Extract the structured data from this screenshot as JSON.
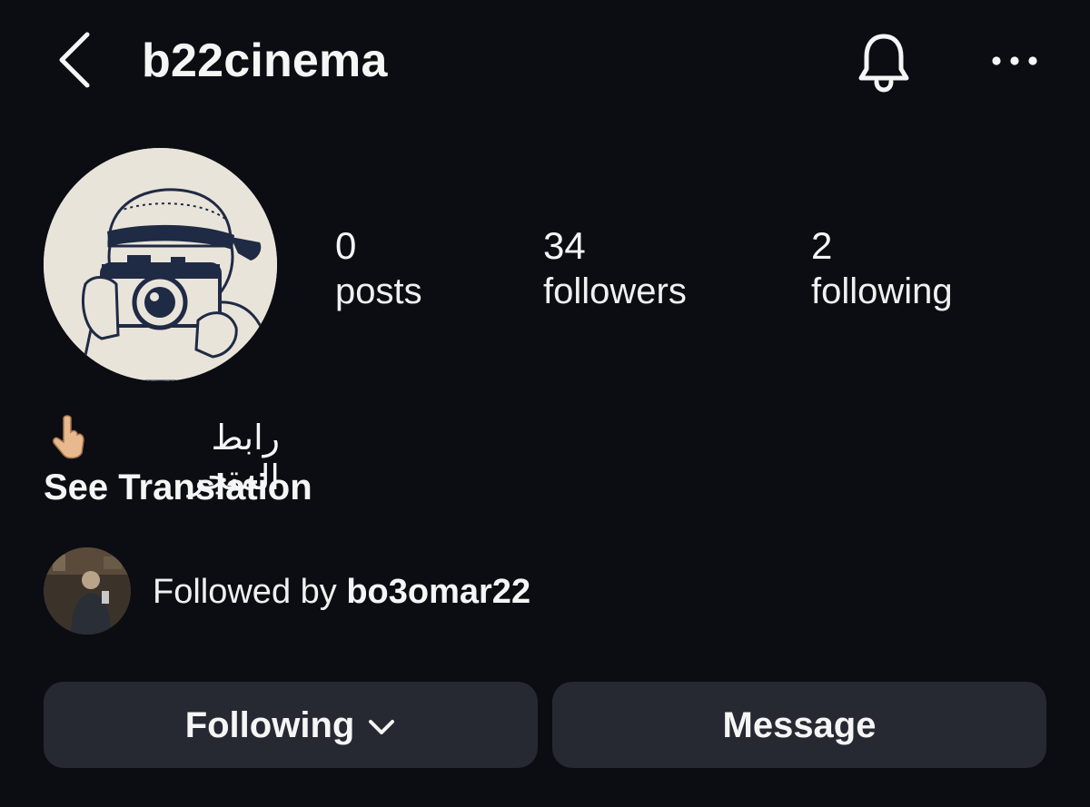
{
  "header": {
    "username": "b22cinema",
    "back_icon": "chevron-left-icon",
    "notification_icon": "bell-icon",
    "more_icon": "ellipsis-icon"
  },
  "stats": [
    {
      "value": "0",
      "label": "posts"
    },
    {
      "value": "34",
      "label": "followers"
    },
    {
      "value": "2",
      "label": "following"
    }
  ],
  "bio": {
    "text": "رابط المتجر",
    "emoji": "👇🏼",
    "see_translation": "See Translation"
  },
  "mutual": {
    "prefix": "Followed by ",
    "name": "bo3omar22"
  },
  "actions": {
    "following_label": "Following",
    "message_label": "Message"
  },
  "colors": {
    "background": "#0b0d12",
    "button_bg": "#262932",
    "text": "#f5f5f5",
    "avatar_bg": "#e9e4da",
    "illustration_ink": "#1f2a44"
  }
}
